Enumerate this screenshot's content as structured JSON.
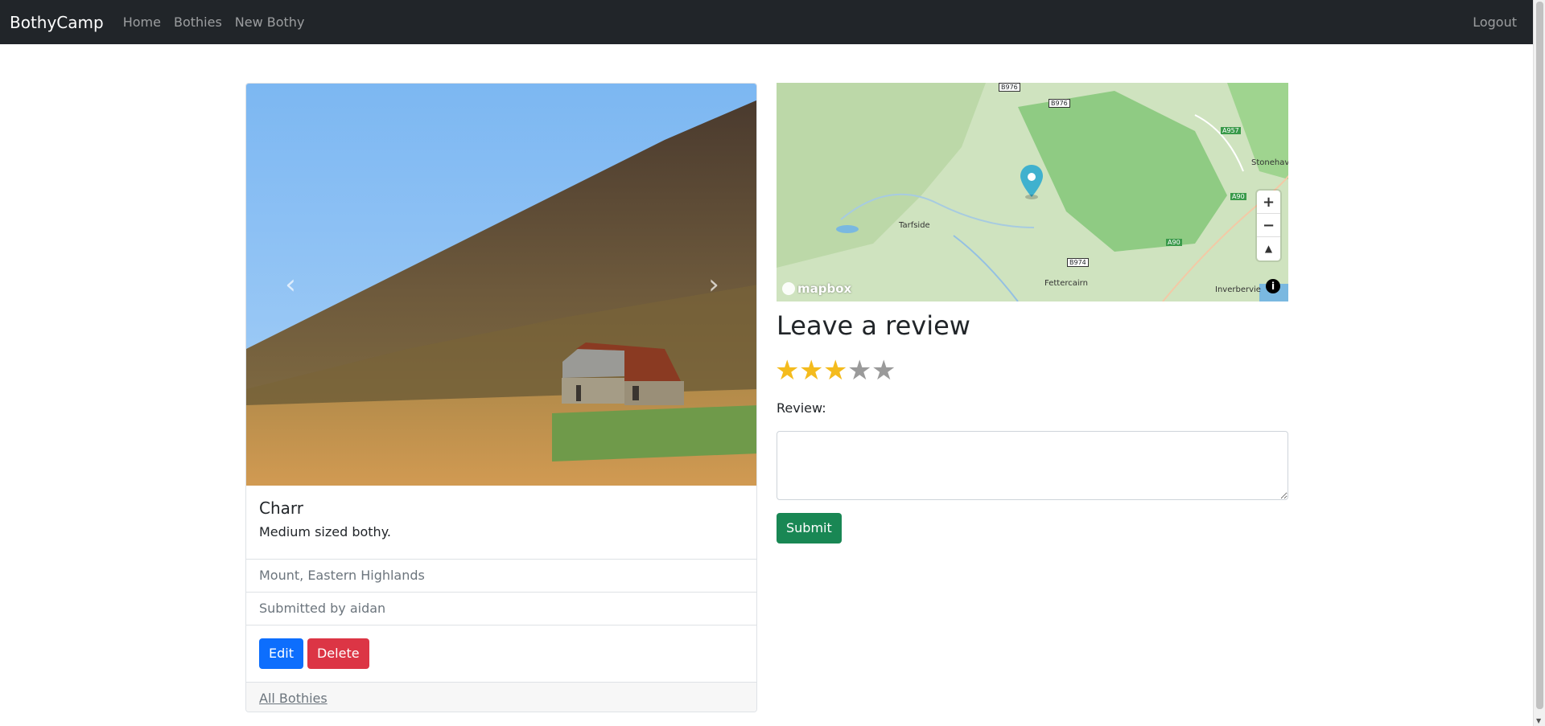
{
  "nav": {
    "brand": "BothyCamp",
    "links": [
      "Home",
      "Bothies",
      "New Bothy"
    ],
    "logout": "Logout"
  },
  "bothy": {
    "name": "Charr",
    "description": "Medium sized bothy.",
    "location": "Mount, Eastern Highlands",
    "submitted_by": "Submitted by aidan",
    "edit_label": "Edit",
    "delete_label": "Delete",
    "all_link": "All Bothies"
  },
  "carousel": {
    "prev_icon": "‹",
    "next_icon": "›"
  },
  "map": {
    "place_labels": [
      "Tarfside",
      "Fettercairn",
      "Stonehav",
      "Inverbervie"
    ],
    "road_labels": [
      "B976",
      "B976",
      "A957",
      "A90",
      "A90",
      "B974"
    ],
    "attribution": "mapbox",
    "zoom_in": "+",
    "zoom_out": "−",
    "compass": "▲",
    "info": "i"
  },
  "review": {
    "title": "Leave a review",
    "rating": 3,
    "max_rating": 5,
    "star_glyph": "★",
    "label": "Review:",
    "textarea_value": "",
    "submit_label": "Submit"
  },
  "colors": {
    "navbar": "#212529",
    "primary": "#0d6efd",
    "danger": "#dc3545",
    "success": "#198754",
    "star_on": "#f4bb1d",
    "star_off": "#9a9a9a",
    "marker": "#3fb1ce"
  }
}
